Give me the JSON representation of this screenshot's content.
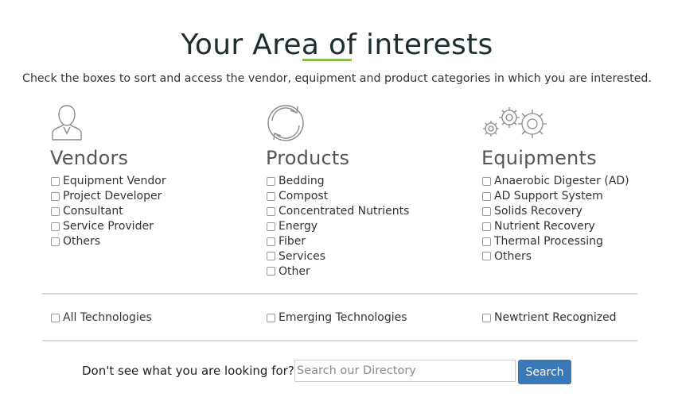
{
  "header": {
    "title": "Your Area of interests",
    "intro": "Check the boxes to sort and access the vendor, equipment and product categories in which you are interested."
  },
  "columns": [
    {
      "icon": "person-icon",
      "title": "Vendors",
      "options": [
        "Equipment Vendor",
        "Project Developer",
        "Consultant",
        "Service Provider",
        "Others"
      ]
    },
    {
      "icon": "recycle-arrows-icon",
      "title": "Products",
      "options": [
        "Bedding",
        "Compost",
        "Concentrated Nutrients",
        "Energy",
        "Fiber",
        "Services",
        "Other"
      ]
    },
    {
      "icon": "gears-icon",
      "title": "Equipments",
      "options": [
        "Anaerobic Digester (AD)",
        "AD Support System",
        "Solids Recovery",
        "Nutrient Recovery",
        "Thermal Processing",
        "Others"
      ]
    }
  ],
  "technologies": [
    "All Technologies",
    "Emerging Technologies",
    "Newtrient Recognized"
  ],
  "search": {
    "label": "Don't see what you are looking for?",
    "placeholder": "Search our Directory",
    "value": "",
    "button_label": "Search"
  },
  "colors": {
    "accent_rule": "#8cbc4e",
    "button": "#3b78b8",
    "title": "#1d2e2e"
  }
}
